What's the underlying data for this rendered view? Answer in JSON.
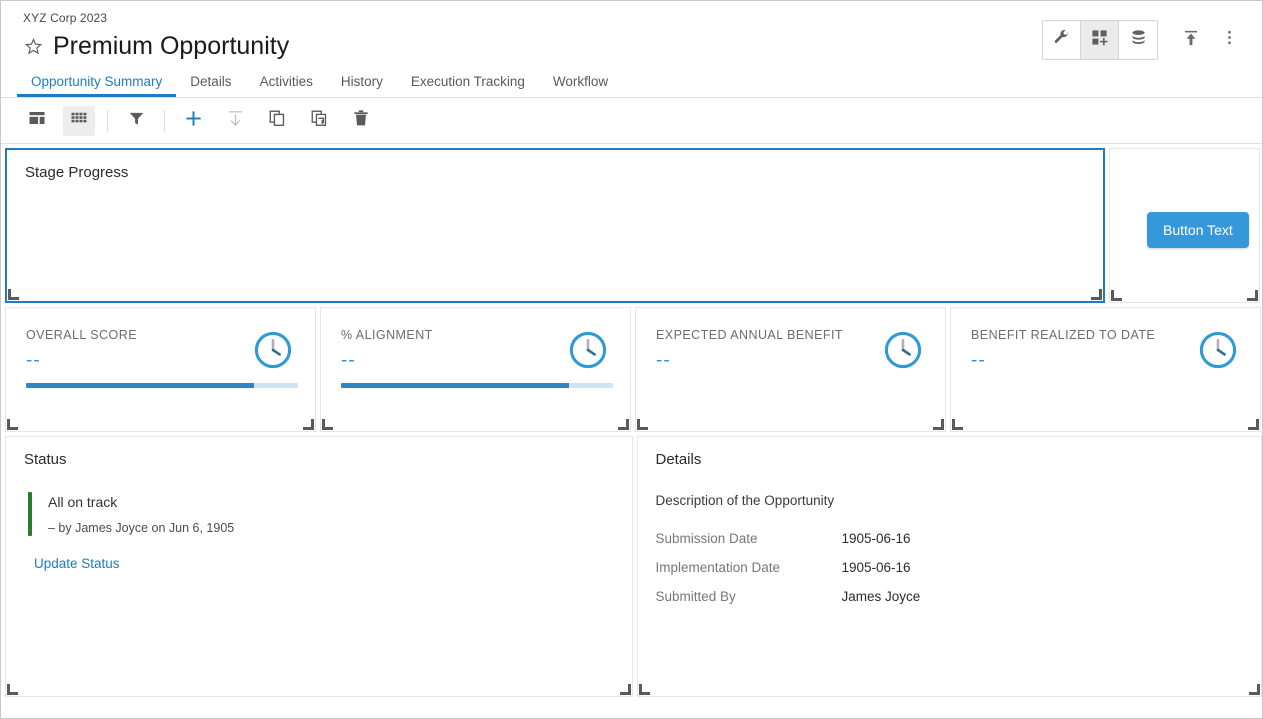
{
  "header": {
    "breadcrumb": "XYZ Corp 2023",
    "title": "Premium Opportunity",
    "star_icon": "star-outline-icon",
    "actions": [
      {
        "name": "wrench-icon",
        "label": "Configure",
        "active": false
      },
      {
        "name": "grid-add-icon",
        "label": "Add Widget",
        "active": true
      },
      {
        "name": "database-icon",
        "label": "Data",
        "active": false
      }
    ],
    "upload_icon": "upload-icon",
    "overflow_icon": "more-vertical-icon"
  },
  "tabs": [
    {
      "label": "Opportunity Summary",
      "active": true
    },
    {
      "label": "Details",
      "active": false
    },
    {
      "label": "Activities",
      "active": false
    },
    {
      "label": "History",
      "active": false
    },
    {
      "label": "Execution Tracking",
      "active": false
    },
    {
      "label": "Workflow",
      "active": false
    }
  ],
  "toolbar": [
    {
      "name": "card-view-icon",
      "label": "Card View",
      "state": "normal",
      "sep_after": false
    },
    {
      "name": "grid-view-icon",
      "label": "Grid View",
      "state": "active",
      "sep_after": true
    },
    {
      "name": "filter-icon",
      "label": "Filter",
      "state": "normal",
      "sep_after": true
    },
    {
      "name": "add-icon",
      "label": "Add",
      "state": "accent",
      "sep_after": false
    },
    {
      "name": "download-icon",
      "label": "Download",
      "state": "disabled",
      "sep_after": false
    },
    {
      "name": "copy-icon",
      "label": "Copy",
      "state": "normal",
      "sep_after": false
    },
    {
      "name": "duplicate-icon",
      "label": "Duplicate",
      "state": "normal",
      "sep_after": false
    },
    {
      "name": "delete-icon",
      "label": "Delete",
      "state": "normal",
      "sep_after": false
    }
  ],
  "stage_panel": {
    "title": "Stage Progress",
    "selected": true
  },
  "button_panel": {
    "button_label": "Button Text",
    "button_color": "#3498db"
  },
  "kpis": [
    {
      "label": "OVERALL SCORE",
      "value": "--",
      "has_bar": true,
      "progress": 84,
      "icon": "clock-icon"
    },
    {
      "label": "% ALIGNMENT",
      "value": "--",
      "has_bar": true,
      "progress": 84,
      "icon": "clock-icon"
    },
    {
      "label": "EXPECTED ANNUAL BENEFIT",
      "value": "--",
      "has_bar": false,
      "progress": 0,
      "icon": "clock-icon"
    },
    {
      "label": "BENEFIT REALIZED TO DATE",
      "value": "--",
      "has_bar": false,
      "progress": 0,
      "icon": "clock-icon"
    }
  ],
  "status": {
    "title": "Status",
    "message": "All on track",
    "byline": "– by James Joyce on Jun 6, 1905",
    "accent_color": "#2d7b2d",
    "link_label": "Update Status"
  },
  "details": {
    "title": "Details",
    "description": "Description of the Opportunity",
    "rows": [
      {
        "label": "Submission Date",
        "value": "1905-06-16"
      },
      {
        "label": "Implementation Date",
        "value": "1905-06-16"
      },
      {
        "label": "Submitted By",
        "value": "James Joyce"
      }
    ]
  },
  "theme": {
    "accent": "#1f7bbf",
    "kpi_accent": "#2e87c4",
    "button": "#3498db",
    "status_green": "#2d7b2d"
  }
}
